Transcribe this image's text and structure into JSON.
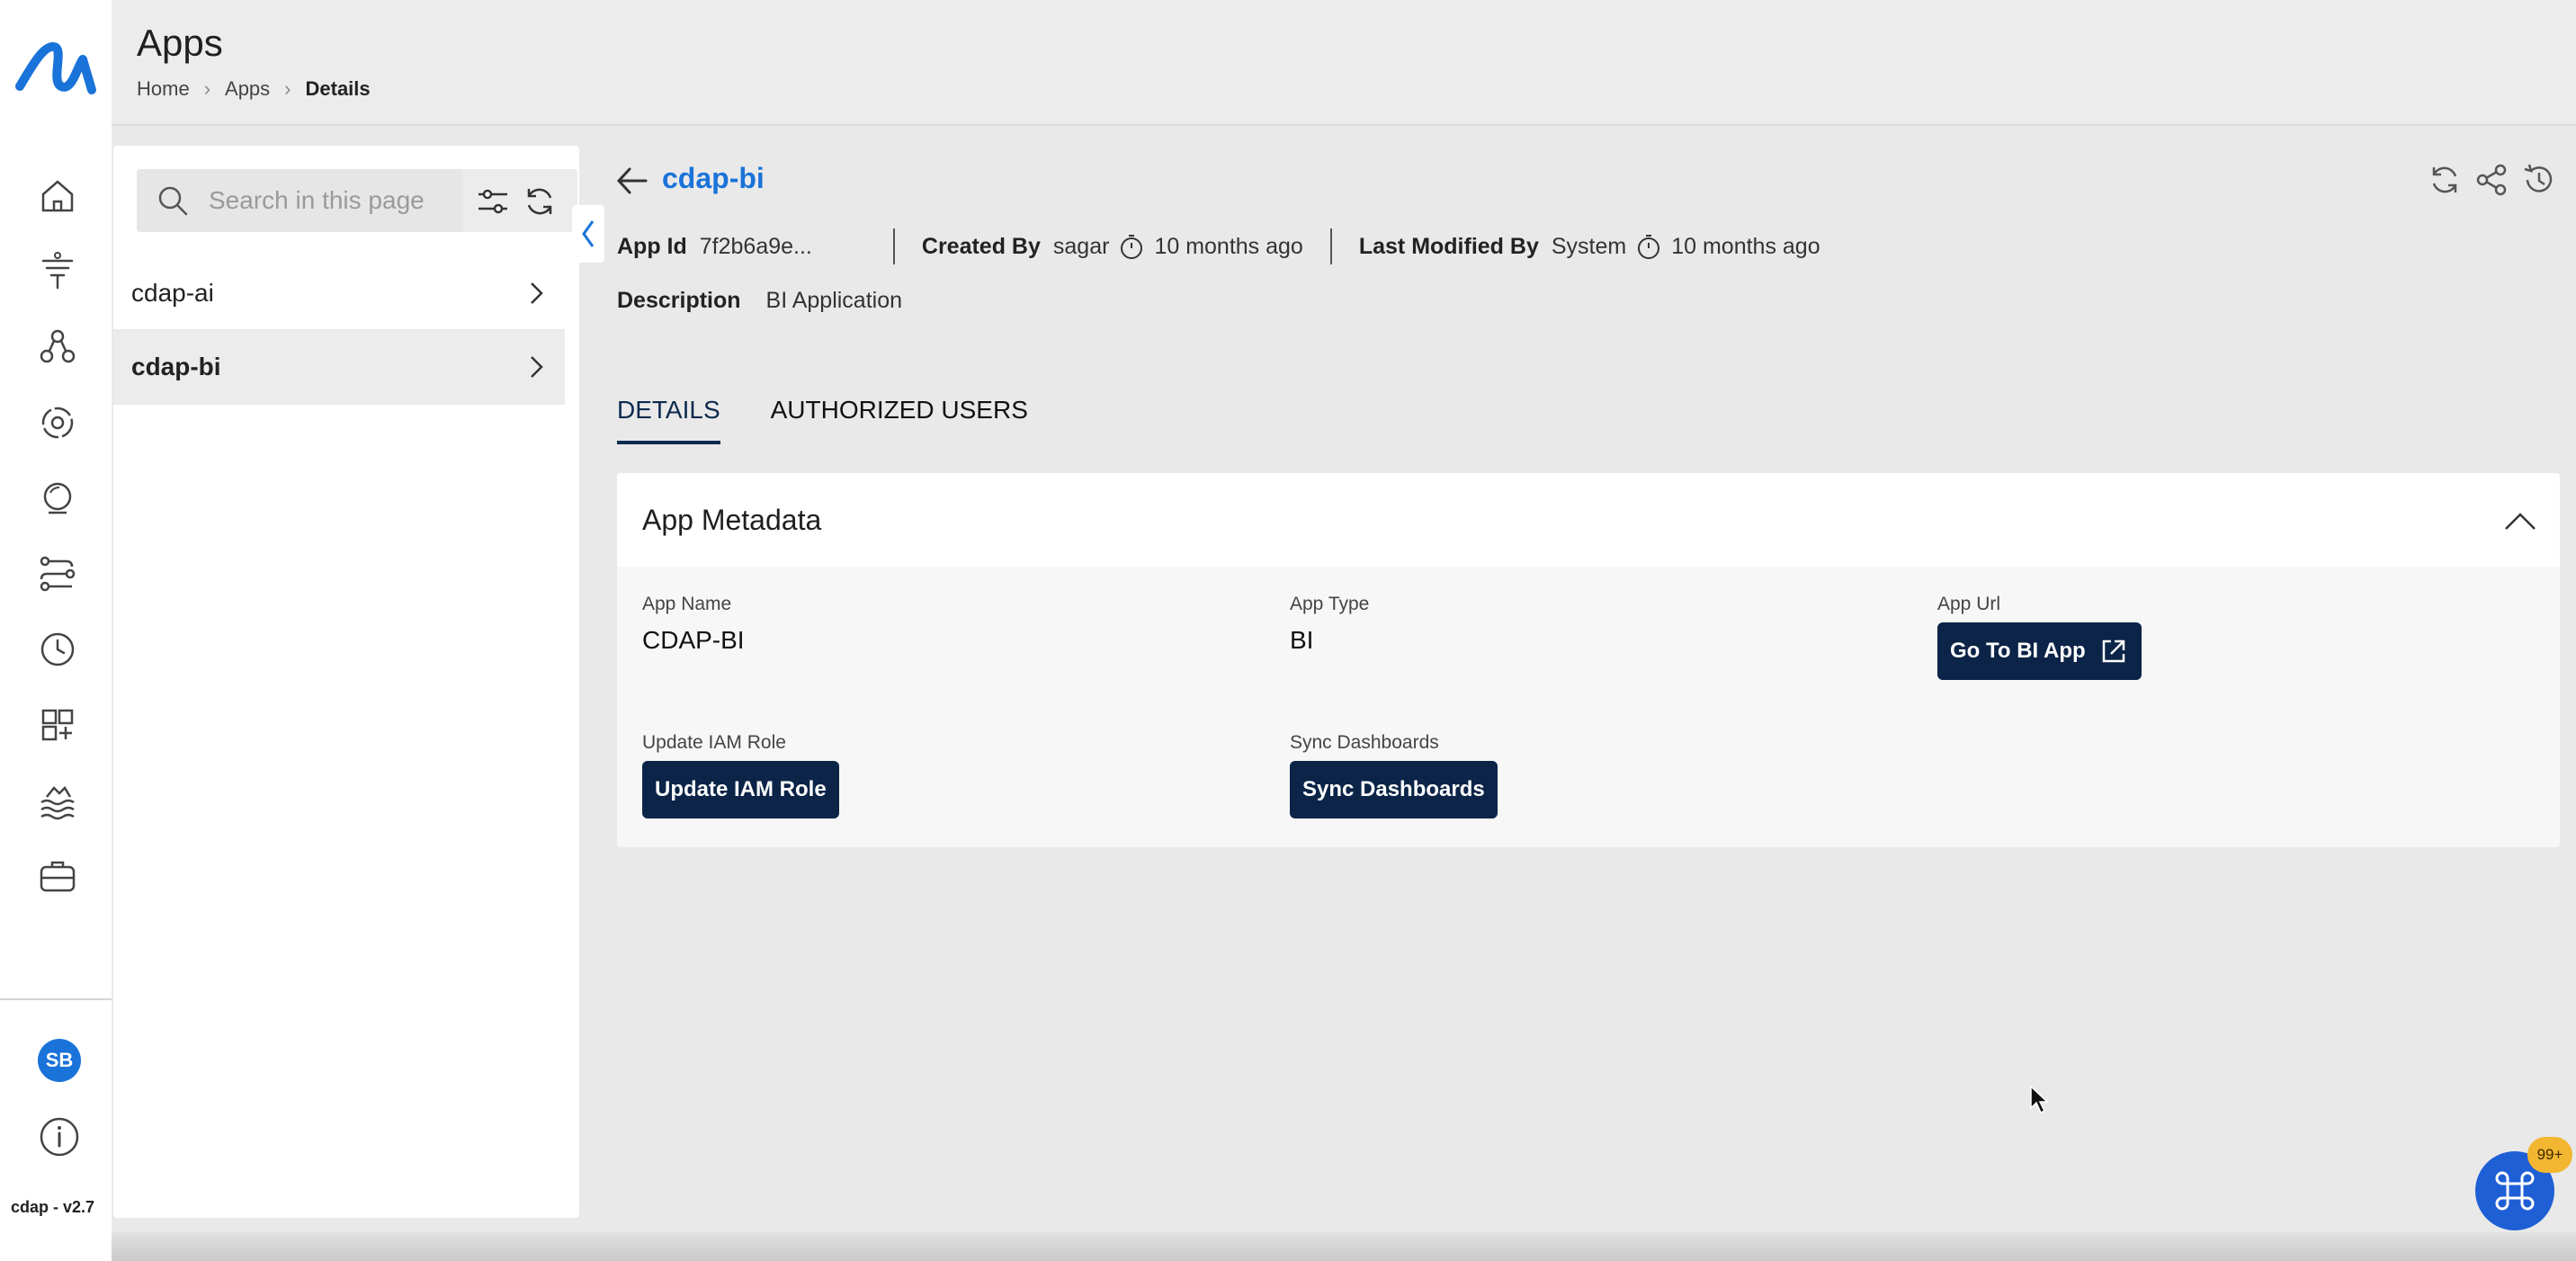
{
  "app": {
    "version": "cdap - v2.7",
    "user_initials": "SB"
  },
  "header": {
    "title": "Apps",
    "breadcrumb": [
      "Home",
      "Apps",
      "Details"
    ]
  },
  "list": {
    "search_placeholder": "Search in this page",
    "items": [
      {
        "label": "cdap-ai",
        "selected": false
      },
      {
        "label": "cdap-bi",
        "selected": true
      }
    ]
  },
  "detail": {
    "title": "cdap-bi",
    "app_id_label": "App Id",
    "app_id_value": "7f2b6a9e...",
    "created_by_label": "Created By",
    "created_by_value": "sagar",
    "created_time": "10 months ago",
    "modified_by_label": "Last Modified By",
    "modified_by_value": "System",
    "modified_time": "10 months ago",
    "description_label": "Description",
    "description_value": "BI Application",
    "tabs": [
      {
        "label": "DETAILS",
        "active": true
      },
      {
        "label": "AUTHORIZED USERS",
        "active": false
      }
    ]
  },
  "metadata": {
    "title": "App Metadata",
    "app_name_label": "App Name",
    "app_name_value": "CDAP-BI",
    "app_type_label": "App Type",
    "app_type_value": "BI",
    "app_url_label": "App Url",
    "app_url_button": "Go To BI App",
    "iam_label": "Update IAM Role",
    "iam_button": "Update IAM Role",
    "sync_label": "Sync Dashboards",
    "sync_button": "Sync Dashboards"
  },
  "fab": {
    "badge": "99+"
  },
  "colors": {
    "accent": "#1a73d9",
    "button": "#0b2447",
    "badge": "#f2b630"
  }
}
